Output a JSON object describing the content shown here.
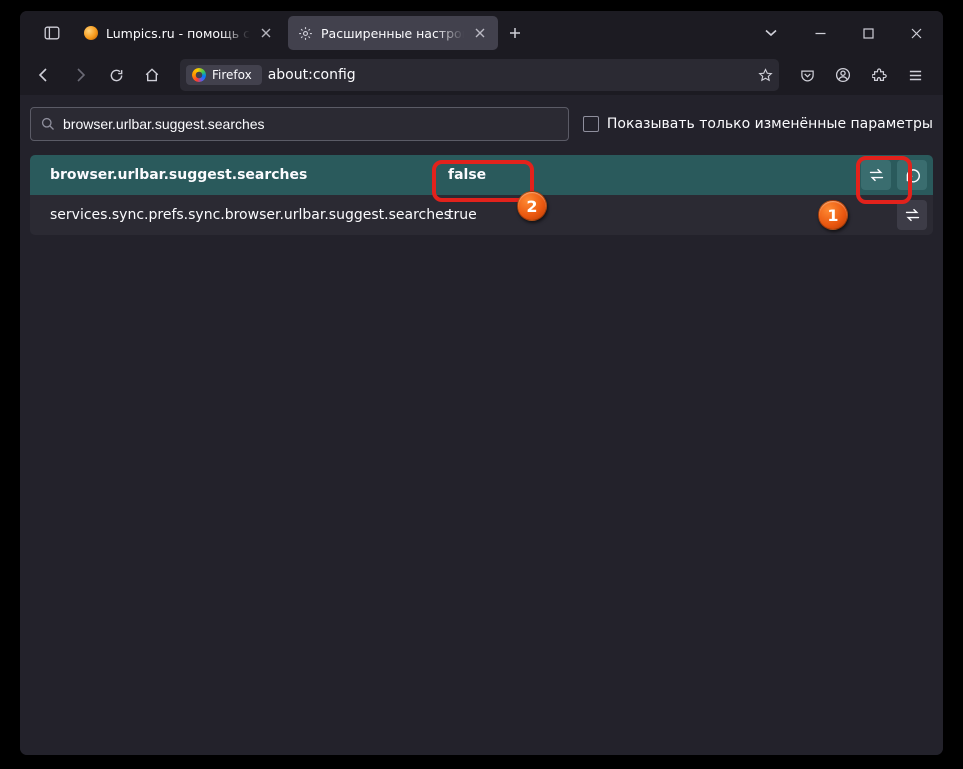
{
  "tabs": [
    {
      "title": "Lumpics.ru - помощь с компьютером",
      "active": false
    },
    {
      "title": "Расширенные настройки",
      "active": true
    }
  ],
  "identity_label": "Firefox",
  "url": "about:config",
  "search_value": "browser.urlbar.suggest.searches",
  "show_modified_label": "Показывать только изменённые параметры",
  "rows": [
    {
      "name": "browser.urlbar.suggest.searches",
      "value": "false",
      "highlight": true,
      "reset": true
    },
    {
      "name": "services.sync.prefs.sync.browser.urlbar.suggest.searches",
      "value": "true",
      "highlight": false,
      "reset": false
    }
  ],
  "badges": {
    "b1": "1",
    "b2": "2"
  }
}
